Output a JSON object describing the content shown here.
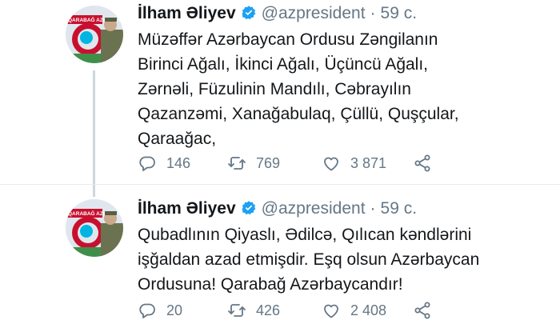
{
  "tweets": [
    {
      "author_name": "İlham Əliyev",
      "handle": "@azpresident",
      "separator": "·",
      "time": "59 с.",
      "lines": [
        "Müzəffər Azərbaycan Ordusu Zəngilanın",
        "Birinci Ağalı, İkinci Ağalı, Üçüncü Ağalı,",
        "Zərnəli, Füzulinin Mandılı, Cəbrayılın",
        "Qazanzəmi, Xanağabulaq, Çüllü, Quşçular,",
        "Qaraağac,"
      ],
      "replies": "146",
      "retweets": "769",
      "likes": "3 871",
      "avatar_banner": "QARABAĞ AZƏRBAYCANDIR"
    },
    {
      "author_name": "İlham Əliyev",
      "handle": "@azpresident",
      "separator": "·",
      "time": "59 с.",
      "lines": [
        "Qubadlının Qiyaslı, Ədilcə, Qılıcan kəndlərini",
        "işğaldan azad etmişdir. Eşq olsun Azərbaycan",
        "Ordusuna! Qarabağ Azərbaycandır!"
      ],
      "replies": "20",
      "retweets": "426",
      "likes": "2 408",
      "avatar_banner": "QARABAĞ AZƏRBAYCANDIR"
    }
  ],
  "icons": {
    "reply": "reply-icon",
    "retweet": "retweet-icon",
    "like": "like-icon",
    "share": "share-icon",
    "verified": "verified-badge-icon"
  },
  "colors": {
    "text": "#14171a",
    "muted": "#657786",
    "verified": "#1da1f2",
    "thread_line": "#ccd6dd"
  }
}
